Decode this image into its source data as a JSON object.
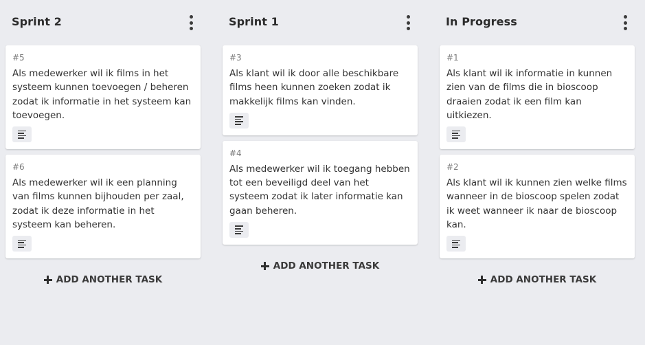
{
  "columns": [
    {
      "title": "Sprint 2",
      "add_label": "ADD ANOTHER TASK",
      "cards": [
        {
          "id": "#5",
          "text": "Als medewerker wil ik films in het systeem kunnen toevoegen / beheren zodat ik informatie in het systeem kan toevoegen."
        },
        {
          "id": "#6",
          "text": "Als medewerker wil ik een planning van films kunnen bijhouden per zaal, zodat ik deze informatie in het systeem kan beheren."
        }
      ]
    },
    {
      "title": "Sprint 1",
      "add_label": "ADD ANOTHER TASK",
      "cards": [
        {
          "id": "#3",
          "text": "Als klant wil ik door alle beschikbare films heen kunnen zoeken zodat ik makkelijk films kan vinden."
        },
        {
          "id": "#4",
          "text": "Als medewerker wil ik toegang hebben tot een beveiligd deel van het systeem zodat ik later informatie kan gaan beheren."
        }
      ]
    },
    {
      "title": "In Progress",
      "add_label": "ADD ANOTHER TASK",
      "cards": [
        {
          "id": "#1",
          "text": "Als klant wil ik informatie in kunnen zien van de films die in bioscoop draaien zodat ik een film kan uitkiezen."
        },
        {
          "id": "#2",
          "text": "Als klant wil ik kunnen zien welke films wanneer in de bioscoop spelen zodat ik weet wanneer ik naar de bioscoop kan."
        }
      ]
    }
  ],
  "icons": {
    "column_menu": "more-vertical-icon",
    "card_description": "description-lines-icon",
    "add_task": "plus-icon"
  },
  "colors": {
    "board_background": "#ebecf0",
    "card_background": "#ffffff",
    "text": "#333333",
    "muted_text": "#7a7a7a"
  }
}
